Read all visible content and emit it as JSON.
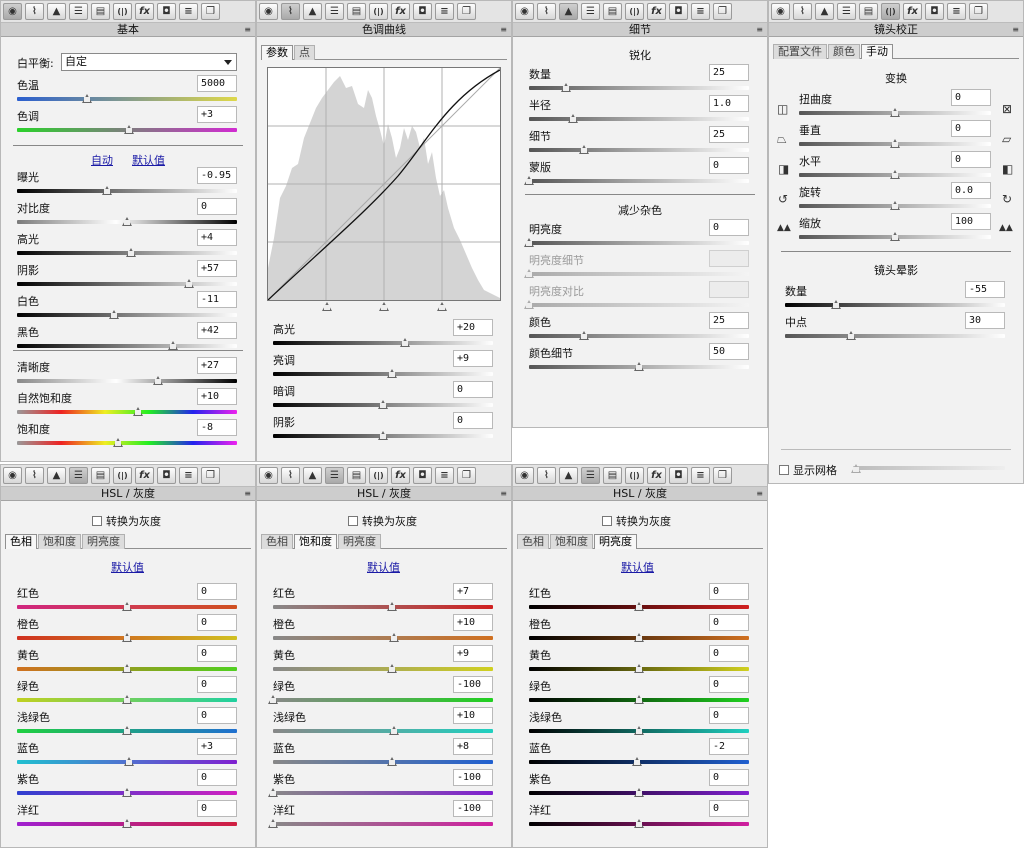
{
  "toolbar_icons": [
    "aperture-icon",
    "curves-icon",
    "mountain-icon",
    "split-icon",
    "toning-icon",
    "lens-icon",
    "fx-icon",
    "camera-icon",
    "sliders-icon",
    "presets-icon"
  ],
  "menu_glyph": "≡",
  "basic": {
    "title": "基本",
    "wb_label": "白平衡:",
    "wb_value": "自定",
    "auto": "自动",
    "default": "默认值",
    "s1": [
      {
        "label": "色温",
        "value": "5000",
        "pos": 0.32,
        "track": "linear-gradient(90deg,#2b5fcf,#ded84a)"
      },
      {
        "label": "色调",
        "value": "+3",
        "pos": 0.51,
        "track": "linear-gradient(90deg,#2bd12b,#d12bd1)"
      }
    ],
    "s2": [
      {
        "label": "曝光",
        "value": "-0.95",
        "pos": 0.41,
        "track": "linear-gradient(90deg,#000,#fff)"
      },
      {
        "label": "对比度",
        "value": "0",
        "pos": 0.5,
        "track": "linear-gradient(90deg,#7a7a7a,#fff 45%,#000)"
      },
      {
        "label": "高光",
        "value": "+4",
        "pos": 0.52,
        "track": "linear-gradient(90deg,#000,#fff)"
      },
      {
        "label": "阴影",
        "value": "+57",
        "pos": 0.78,
        "track": "linear-gradient(90deg,#000,#fff)"
      },
      {
        "label": "白色",
        "value": "-11",
        "pos": 0.44,
        "track": "linear-gradient(90deg,#000,#fff)"
      },
      {
        "label": "黑色",
        "value": "+42",
        "pos": 0.71,
        "track": "linear-gradient(90deg,#000,#fff)"
      }
    ],
    "s3": [
      {
        "label": "清晰度",
        "value": "+27",
        "pos": 0.64,
        "track": "linear-gradient(90deg,#888,#fff 45%,#000)"
      },
      {
        "label": "自然饱和度",
        "value": "+10",
        "pos": 0.55,
        "track": "linear-gradient(90deg,#999,#e22,#ee2,#2e2,#22e,#e2e)"
      },
      {
        "label": "饱和度",
        "value": "-8",
        "pos": 0.46,
        "track": "linear-gradient(90deg,#999,#e22,#ee2,#2e2,#22e,#e2e)"
      }
    ]
  },
  "curve": {
    "title": "色调曲线",
    "tabs": [
      "参数",
      "点"
    ],
    "active_tab": 0,
    "sliders": [
      {
        "label": "高光",
        "value": "+20",
        "pos": 0.6,
        "track": "linear-gradient(90deg,#000,#fff)"
      },
      {
        "label": "亮调",
        "value": "+9",
        "pos": 0.54,
        "track": "linear-gradient(90deg,#000,#fff)"
      },
      {
        "label": "暗调",
        "value": "0",
        "pos": 0.5,
        "track": "linear-gradient(90deg,#000,#fff)"
      },
      {
        "label": "阴影",
        "value": "0",
        "pos": 0.5,
        "track": "linear-gradient(90deg,#000,#fff)"
      }
    ]
  },
  "detail": {
    "title": "细节",
    "sharpen_title": "锐化",
    "noise_title": "减少杂色",
    "sharpen": [
      {
        "label": "数量",
        "value": "25",
        "pos": 0.17,
        "track": "linear-gradient(90deg,#555,#fff)"
      },
      {
        "label": "半径",
        "value": "1.0",
        "pos": 0.2,
        "track": "linear-gradient(90deg,#555,#fff)"
      },
      {
        "label": "细节",
        "value": "25",
        "pos": 0.25,
        "track": "linear-gradient(90deg,#555,#fff)"
      },
      {
        "label": "蒙版",
        "value": "0",
        "pos": 0.0,
        "track": "linear-gradient(90deg,#555,#fff)"
      }
    ],
    "noise": [
      {
        "label": "明亮度",
        "value": "0",
        "pos": 0.0,
        "track": "linear-gradient(90deg,#555,#fff)"
      },
      {
        "label": "明亮度细节",
        "value": "",
        "pos": 0.0,
        "dis": true,
        "track": "linear-gradient(90deg,#aaa,#f4f4f4)"
      },
      {
        "label": "明亮度对比",
        "value": "",
        "pos": 0.0,
        "dis": true,
        "track": "linear-gradient(90deg,#aaa,#f4f4f4)"
      },
      {
        "label": "颜色",
        "value": "25",
        "pos": 0.25,
        "track": "linear-gradient(90deg,#555,#fff)"
      },
      {
        "label": "颜色细节",
        "value": "50",
        "pos": 0.5,
        "track": "linear-gradient(90deg,#555,#fff)"
      }
    ]
  },
  "lens": {
    "title": "镜头校正",
    "tabs": [
      "配置文件",
      "颜色",
      "手动"
    ],
    "active_tab": 2,
    "transform_title": "变换",
    "vignette_title": "镜头晕影",
    "grid_label": "显示网格",
    "transform": [
      {
        "label": "扭曲度",
        "value": "0",
        "pos": 0.5,
        "track": "linear-gradient(90deg,#555,#fff)"
      },
      {
        "label": "垂直",
        "value": "0",
        "pos": 0.5,
        "track": "linear-gradient(90deg,#555,#fff)"
      },
      {
        "label": "水平",
        "value": "0",
        "pos": 0.5,
        "track": "linear-gradient(90deg,#555,#fff)"
      },
      {
        "label": "旋转",
        "value": "0.0",
        "pos": 0.5,
        "track": "linear-gradient(90deg,#555,#fff)"
      },
      {
        "label": "缩放",
        "value": "100",
        "pos": 0.5,
        "track": "linear-gradient(90deg,#555,#fff)"
      }
    ],
    "vignette": [
      {
        "label": "数量",
        "value": "-55",
        "pos": 0.23,
        "track": "linear-gradient(90deg,#000,#fff)"
      },
      {
        "label": "中点",
        "value": "30",
        "pos": 0.3,
        "track": "linear-gradient(90deg,#555,#fff)"
      }
    ]
  },
  "hsl": {
    "title": "HSL / 灰度",
    "gray_label": "转换为灰度",
    "tabs": [
      "色相",
      "饱和度",
      "明亮度"
    ],
    "default": "默认值",
    "hue": [
      {
        "label": "红色",
        "value": "0",
        "pos": 0.5,
        "track": "linear-gradient(90deg,#d02680,#d05020)"
      },
      {
        "label": "橙色",
        "value": "0",
        "pos": 0.5,
        "track": "linear-gradient(90deg,#d03020,#d0c020)"
      },
      {
        "label": "黄色",
        "value": "0",
        "pos": 0.5,
        "track": "linear-gradient(90deg,#d07020,#50d020)"
      },
      {
        "label": "绿色",
        "value": "0",
        "pos": 0.5,
        "track": "linear-gradient(90deg,#c0d020,#20d0a0)"
      },
      {
        "label": "浅绿色",
        "value": "0",
        "pos": 0.5,
        "track": "linear-gradient(90deg,#20d040,#2070d0)"
      },
      {
        "label": "蓝色",
        "value": "+3",
        "pos": 0.51,
        "track": "linear-gradient(90deg,#20c0d0,#8020d0)"
      },
      {
        "label": "紫色",
        "value": "0",
        "pos": 0.5,
        "track": "linear-gradient(90deg,#3040d0,#d020c0)"
      },
      {
        "label": "洋红",
        "value": "0",
        "pos": 0.5,
        "track": "linear-gradient(90deg,#a020d0,#d02040)"
      }
    ],
    "sat": [
      {
        "label": "红色",
        "value": "+7",
        "pos": 0.54,
        "track": "linear-gradient(90deg,#888,#d02020)"
      },
      {
        "label": "橙色",
        "value": "+10",
        "pos": 0.55,
        "track": "linear-gradient(90deg,#888,#d07020)"
      },
      {
        "label": "黄色",
        "value": "+9",
        "pos": 0.54,
        "track": "linear-gradient(90deg,#888,#d0d020)"
      },
      {
        "label": "绿色",
        "value": "-100",
        "pos": 0.0,
        "track": "linear-gradient(90deg,#888,#20d020)"
      },
      {
        "label": "浅绿色",
        "value": "+10",
        "pos": 0.55,
        "track": "linear-gradient(90deg,#888,#20d0c0)"
      },
      {
        "label": "蓝色",
        "value": "+8",
        "pos": 0.54,
        "track": "linear-gradient(90deg,#888,#2060d0)"
      },
      {
        "label": "紫色",
        "value": "-100",
        "pos": 0.0,
        "track": "linear-gradient(90deg,#888,#8020d0)"
      },
      {
        "label": "洋红",
        "value": "-100",
        "pos": 0.0,
        "track": "linear-gradient(90deg,#888,#d020a0)"
      }
    ],
    "lum": [
      {
        "label": "红色",
        "value": "0",
        "pos": 0.5,
        "track": "linear-gradient(90deg,#000,#d02020)"
      },
      {
        "label": "橙色",
        "value": "0",
        "pos": 0.5,
        "track": "linear-gradient(90deg,#000,#d07020)"
      },
      {
        "label": "黄色",
        "value": "0",
        "pos": 0.5,
        "track": "linear-gradient(90deg,#000,#d0d020)"
      },
      {
        "label": "绿色",
        "value": "0",
        "pos": 0.5,
        "track": "linear-gradient(90deg,#000,#20d020)"
      },
      {
        "label": "浅绿色",
        "value": "0",
        "pos": 0.5,
        "track": "linear-gradient(90deg,#000,#20d0c0)"
      },
      {
        "label": "蓝色",
        "value": "-2",
        "pos": 0.49,
        "track": "linear-gradient(90deg,#000,#2060d0)"
      },
      {
        "label": "紫色",
        "value": "0",
        "pos": 0.5,
        "track": "linear-gradient(90deg,#000,#8020d0)"
      },
      {
        "label": "洋红",
        "value": "0",
        "pos": 0.5,
        "track": "linear-gradient(90deg,#000,#d020a0)"
      }
    ]
  }
}
